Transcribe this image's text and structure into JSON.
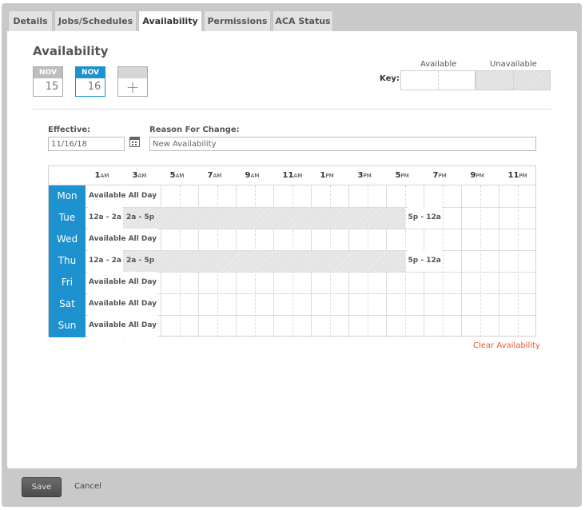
{
  "tabs": [
    {
      "label": "Details"
    },
    {
      "label": "Jobs/Schedules"
    },
    {
      "label": "Availability",
      "active": true
    },
    {
      "label": "Permissions"
    },
    {
      "label": "ACA Status"
    }
  ],
  "section_title": "Availability",
  "dates": [
    {
      "month": "NOV",
      "day": "15",
      "selected": false
    },
    {
      "month": "NOV",
      "day": "16",
      "selected": true
    }
  ],
  "add_date_icon": "plus-icon",
  "key": {
    "label": "Key:",
    "available": "Available",
    "unavailable": "Unavailable"
  },
  "form": {
    "effective_label": "Effective:",
    "effective_value": "11/16/18",
    "calendar_icon": "calendar-icon",
    "reason_label": "Reason For Change:",
    "reason_value": "New Availability"
  },
  "hours": [
    {
      "num": "1",
      "sfx": "AM"
    },
    {
      "num": "3",
      "sfx": "AM"
    },
    {
      "num": "5",
      "sfx": "AM"
    },
    {
      "num": "7",
      "sfx": "AM"
    },
    {
      "num": "9",
      "sfx": "AM"
    },
    {
      "num": "11",
      "sfx": "AM"
    },
    {
      "num": "1",
      "sfx": "PM"
    },
    {
      "num": "3",
      "sfx": "PM"
    },
    {
      "num": "5",
      "sfx": "PM"
    },
    {
      "num": "7",
      "sfx": "PM"
    },
    {
      "num": "9",
      "sfx": "PM"
    },
    {
      "num": "11",
      "sfx": "PM"
    }
  ],
  "days": [
    {
      "name": "Mon",
      "segments": [
        "Available All Day"
      ]
    },
    {
      "name": "Tue",
      "segments": [
        "12a - 2a",
        "2a - 5p",
        "5p - 12a"
      ],
      "unavailable": "2a - 5p"
    },
    {
      "name": "Wed",
      "segments": [
        "Available All Day"
      ]
    },
    {
      "name": "Thu",
      "segments": [
        "12a - 2a",
        "2a - 5p",
        "5p - 12a"
      ],
      "unavailable": "2a - 5p"
    },
    {
      "name": "Fri",
      "segments": [
        "Available All Day"
      ]
    },
    {
      "name": "Sat",
      "segments": [
        "Available All Day"
      ]
    },
    {
      "name": "Sun",
      "segments": [
        "Available All Day"
      ]
    }
  ],
  "clear_label": "Clear Availability",
  "footer": {
    "save_label": "Save",
    "cancel_label": "Cancel"
  },
  "colors": {
    "accent": "#1e91cf",
    "link_orange": "#e8582c",
    "frame_gray": "#c9c9c9"
  }
}
